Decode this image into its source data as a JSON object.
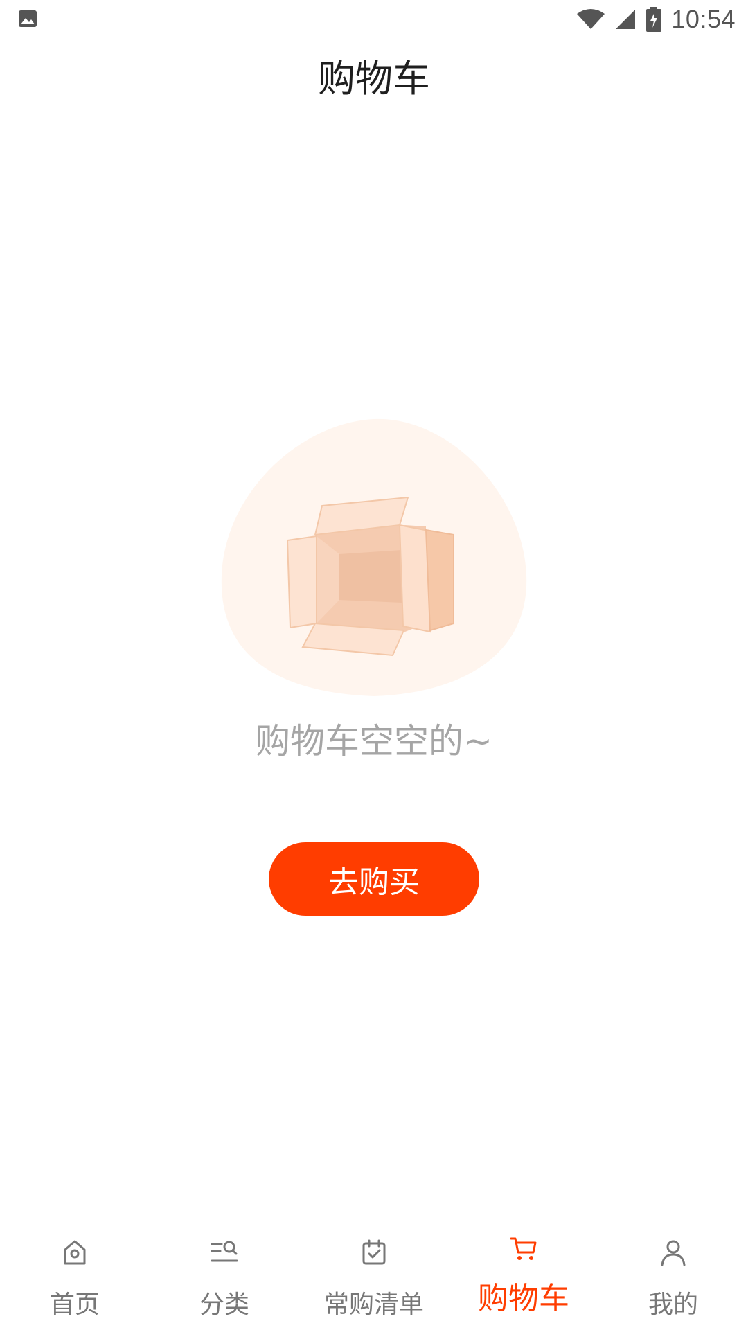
{
  "status_bar": {
    "time": "10:54"
  },
  "header": {
    "title": "购物车"
  },
  "empty_state": {
    "message": "购物车空空的~",
    "button_label": "去购买"
  },
  "tabbar": {
    "items": [
      {
        "label": "首页",
        "icon": "home-icon"
      },
      {
        "label": "分类",
        "icon": "category-icon"
      },
      {
        "label": "常购清单",
        "icon": "calendar-check-icon"
      },
      {
        "label": "购物车",
        "icon": "cart-icon"
      },
      {
        "label": "我的",
        "icon": "user-icon"
      }
    ],
    "active_index": 3
  },
  "colors": {
    "accent": "#ff3d00",
    "inactive": "#777777",
    "illustration_bg": "#fff4ec"
  }
}
